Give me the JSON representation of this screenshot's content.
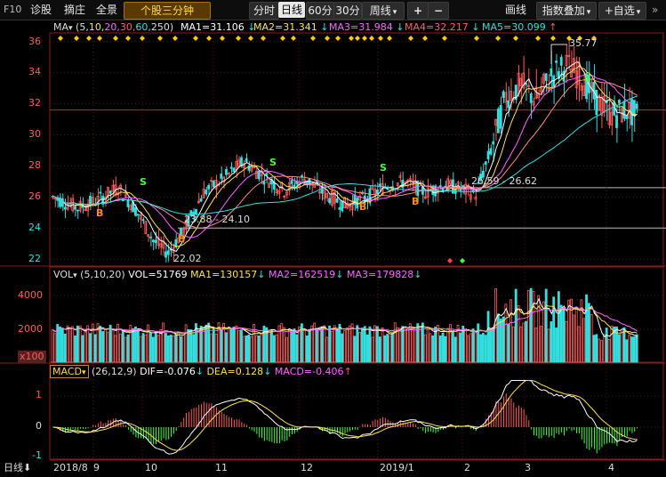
{
  "toolbar": {
    "f10": "F10",
    "items": [
      "诊股",
      "摘庄",
      "全景"
    ],
    "strategy": "个股三分钟",
    "periods": [
      "分时",
      "日线",
      "60分",
      "30分"
    ],
    "active_period": "日线",
    "week": "周线",
    "plus": "+",
    "minus": "−",
    "draw": "画线",
    "index_overlay": "指数叠加",
    "watchlist": "+自选"
  },
  "ma_legend": {
    "name": "MA",
    "params_prefix": "(5,",
    "p10": "10,",
    "p20": "20,",
    "p30": "30,",
    "p60": "60,",
    "p250": "250)",
    "ma1": "MA1=31.106",
    "ma2": "MA2=31.341",
    "ma3": "MA3=31.984",
    "ma4": "MA4=32.217",
    "ma5": "MA5=30.099",
    "arrow_down": "↓",
    "arrow_up": "↑"
  },
  "vol_legend": {
    "name": "VOL",
    "params": "(5,10,20)",
    "vol": "VOL=51769",
    "ma1": "MA1=130157",
    "ma2": "MA2=162519",
    "ma3": "MA3=179828",
    "arrow_down": "↓"
  },
  "macd_legend": {
    "name": "MACD",
    "params": "(26,12,9)",
    "dif": "DIF=-0.076",
    "dea": "DEA=0.128",
    "macd": "MACD=-0.406",
    "arrow_down": "↓",
    "arrow_up": "↑"
  },
  "price_axis": [
    "36",
    "34",
    "32",
    "30",
    "28",
    "26",
    "24",
    "22"
  ],
  "vol_axis": [
    "4000",
    "2000",
    "x100"
  ],
  "macd_axis": [
    "1",
    "0",
    "-1"
  ],
  "time_axis": {
    "period": "日线",
    "labels": [
      "2018/8",
      "9",
      "10",
      "11",
      "12",
      "2019/1",
      "2",
      "3",
      "4"
    ]
  },
  "annotations": {
    "high": "35.77",
    "low": "22.02",
    "range1": "23.88 - 24.10",
    "range2": "26.59 - 26.62",
    "buy": "B",
    "sell": "S"
  },
  "colors": {
    "up": "#ff5c5c",
    "down": "#33e0e0",
    "ma5": "#ffffff",
    "ma10": "#ffe14d",
    "ma20": "#ff66ff",
    "ma30": "#ff8c8c",
    "ma60": "#33e0e0"
  },
  "chart_data": {
    "type": "candlestick",
    "ylim": [
      21.5,
      36.5
    ],
    "last_close": 31.1,
    "ma_last": {
      "ma1": 31.106,
      "ma2": 31.341,
      "ma3": 31.984,
      "ma4": 32.217,
      "ma5": 30.099
    },
    "volume_last": 51769,
    "macd_last": {
      "dif": -0.076,
      "dea": 0.128,
      "macd": -0.406
    }
  }
}
